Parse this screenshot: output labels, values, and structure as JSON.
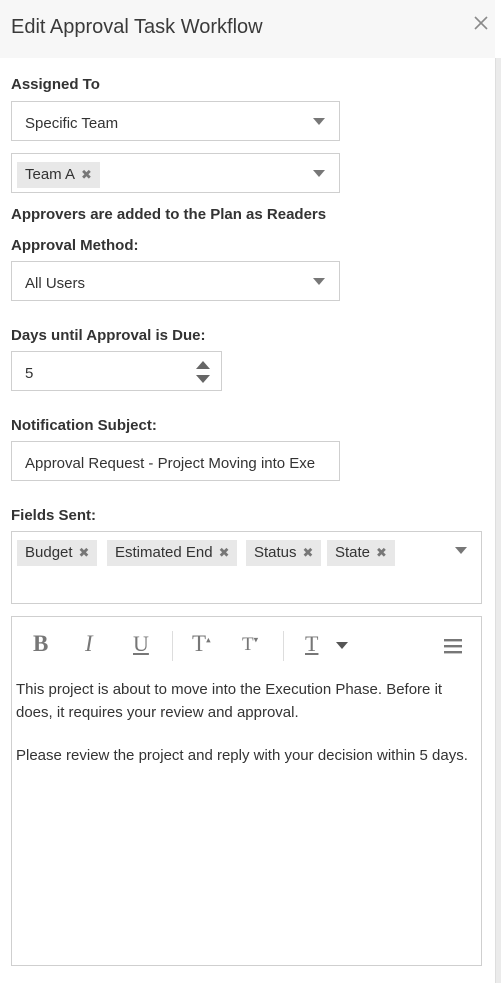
{
  "dialog": {
    "title": "Edit Approval Task Workflow"
  },
  "assigned_to": {
    "label": "Assigned To",
    "type_value": "Specific Team",
    "teams": [
      "Team A"
    ]
  },
  "approvers_note": "Approvers are added to the Plan as Readers",
  "approval_method": {
    "label": "Approval Method:",
    "value": "All Users"
  },
  "days_due": {
    "label": "Days until Approval is Due:",
    "value": "5"
  },
  "notification_subject": {
    "label": "Notification Subject:",
    "value": "Approval Request - Project Moving into Exe"
  },
  "fields_sent": {
    "label": "Fields Sent:",
    "chips": [
      "Budget",
      "Estimated End",
      "Status",
      "State"
    ]
  },
  "editor": {
    "toolbar": {
      "bold": "B",
      "italic": "I",
      "underline": "U",
      "superscript": "T",
      "subscript": "T",
      "format": "T"
    },
    "paragraphs": [
      "This project is about to move into the Execution Phase. Before it does, it requires your review and approval.",
      "Please review the project and reply with your decision within 5 days."
    ]
  },
  "icons": {
    "close": "close-icon",
    "chip_remove": "✖",
    "caret": "chevron-down-icon"
  }
}
